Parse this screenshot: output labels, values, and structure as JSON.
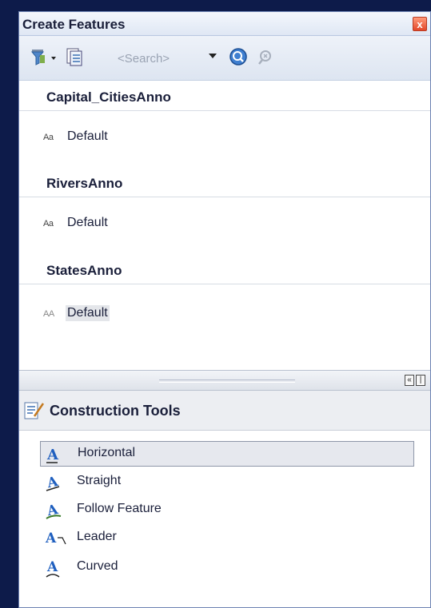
{
  "window": {
    "title": "Create Features",
    "close_label": "x"
  },
  "toolbar": {
    "search_placeholder": "<Search>",
    "icons": [
      "filter-icon",
      "organize-templates-icon",
      "search-icon",
      "clear-search-icon"
    ]
  },
  "templates": {
    "groups": [
      {
        "name": "Capital_CitiesAnno",
        "items": [
          {
            "icon_text": "Aa",
            "label": "Default"
          }
        ]
      },
      {
        "name": "RiversAnno",
        "items": [
          {
            "icon_text": "Aa",
            "label": "Default"
          }
        ]
      },
      {
        "name": "StatesAnno",
        "items": [
          {
            "icon_text": "AA",
            "label": "Default",
            "selected": true
          }
        ]
      }
    ]
  },
  "construction_tools": {
    "title": "Construction Tools",
    "tools": [
      {
        "label": "Horizontal",
        "icon": "horizontal-annotation-icon",
        "selected": true
      },
      {
        "label": "Straight",
        "icon": "straight-annotation-icon"
      },
      {
        "label": "Follow Feature",
        "icon": "follow-feature-annotation-icon"
      },
      {
        "label": "Leader",
        "icon": "leader-annotation-icon"
      },
      {
        "label": "Curved",
        "icon": "curved-annotation-icon"
      }
    ]
  },
  "colors": {
    "background": "#0d1b4a",
    "accent_blue": "#1f5fbf",
    "selection": "#e6e8ee"
  }
}
